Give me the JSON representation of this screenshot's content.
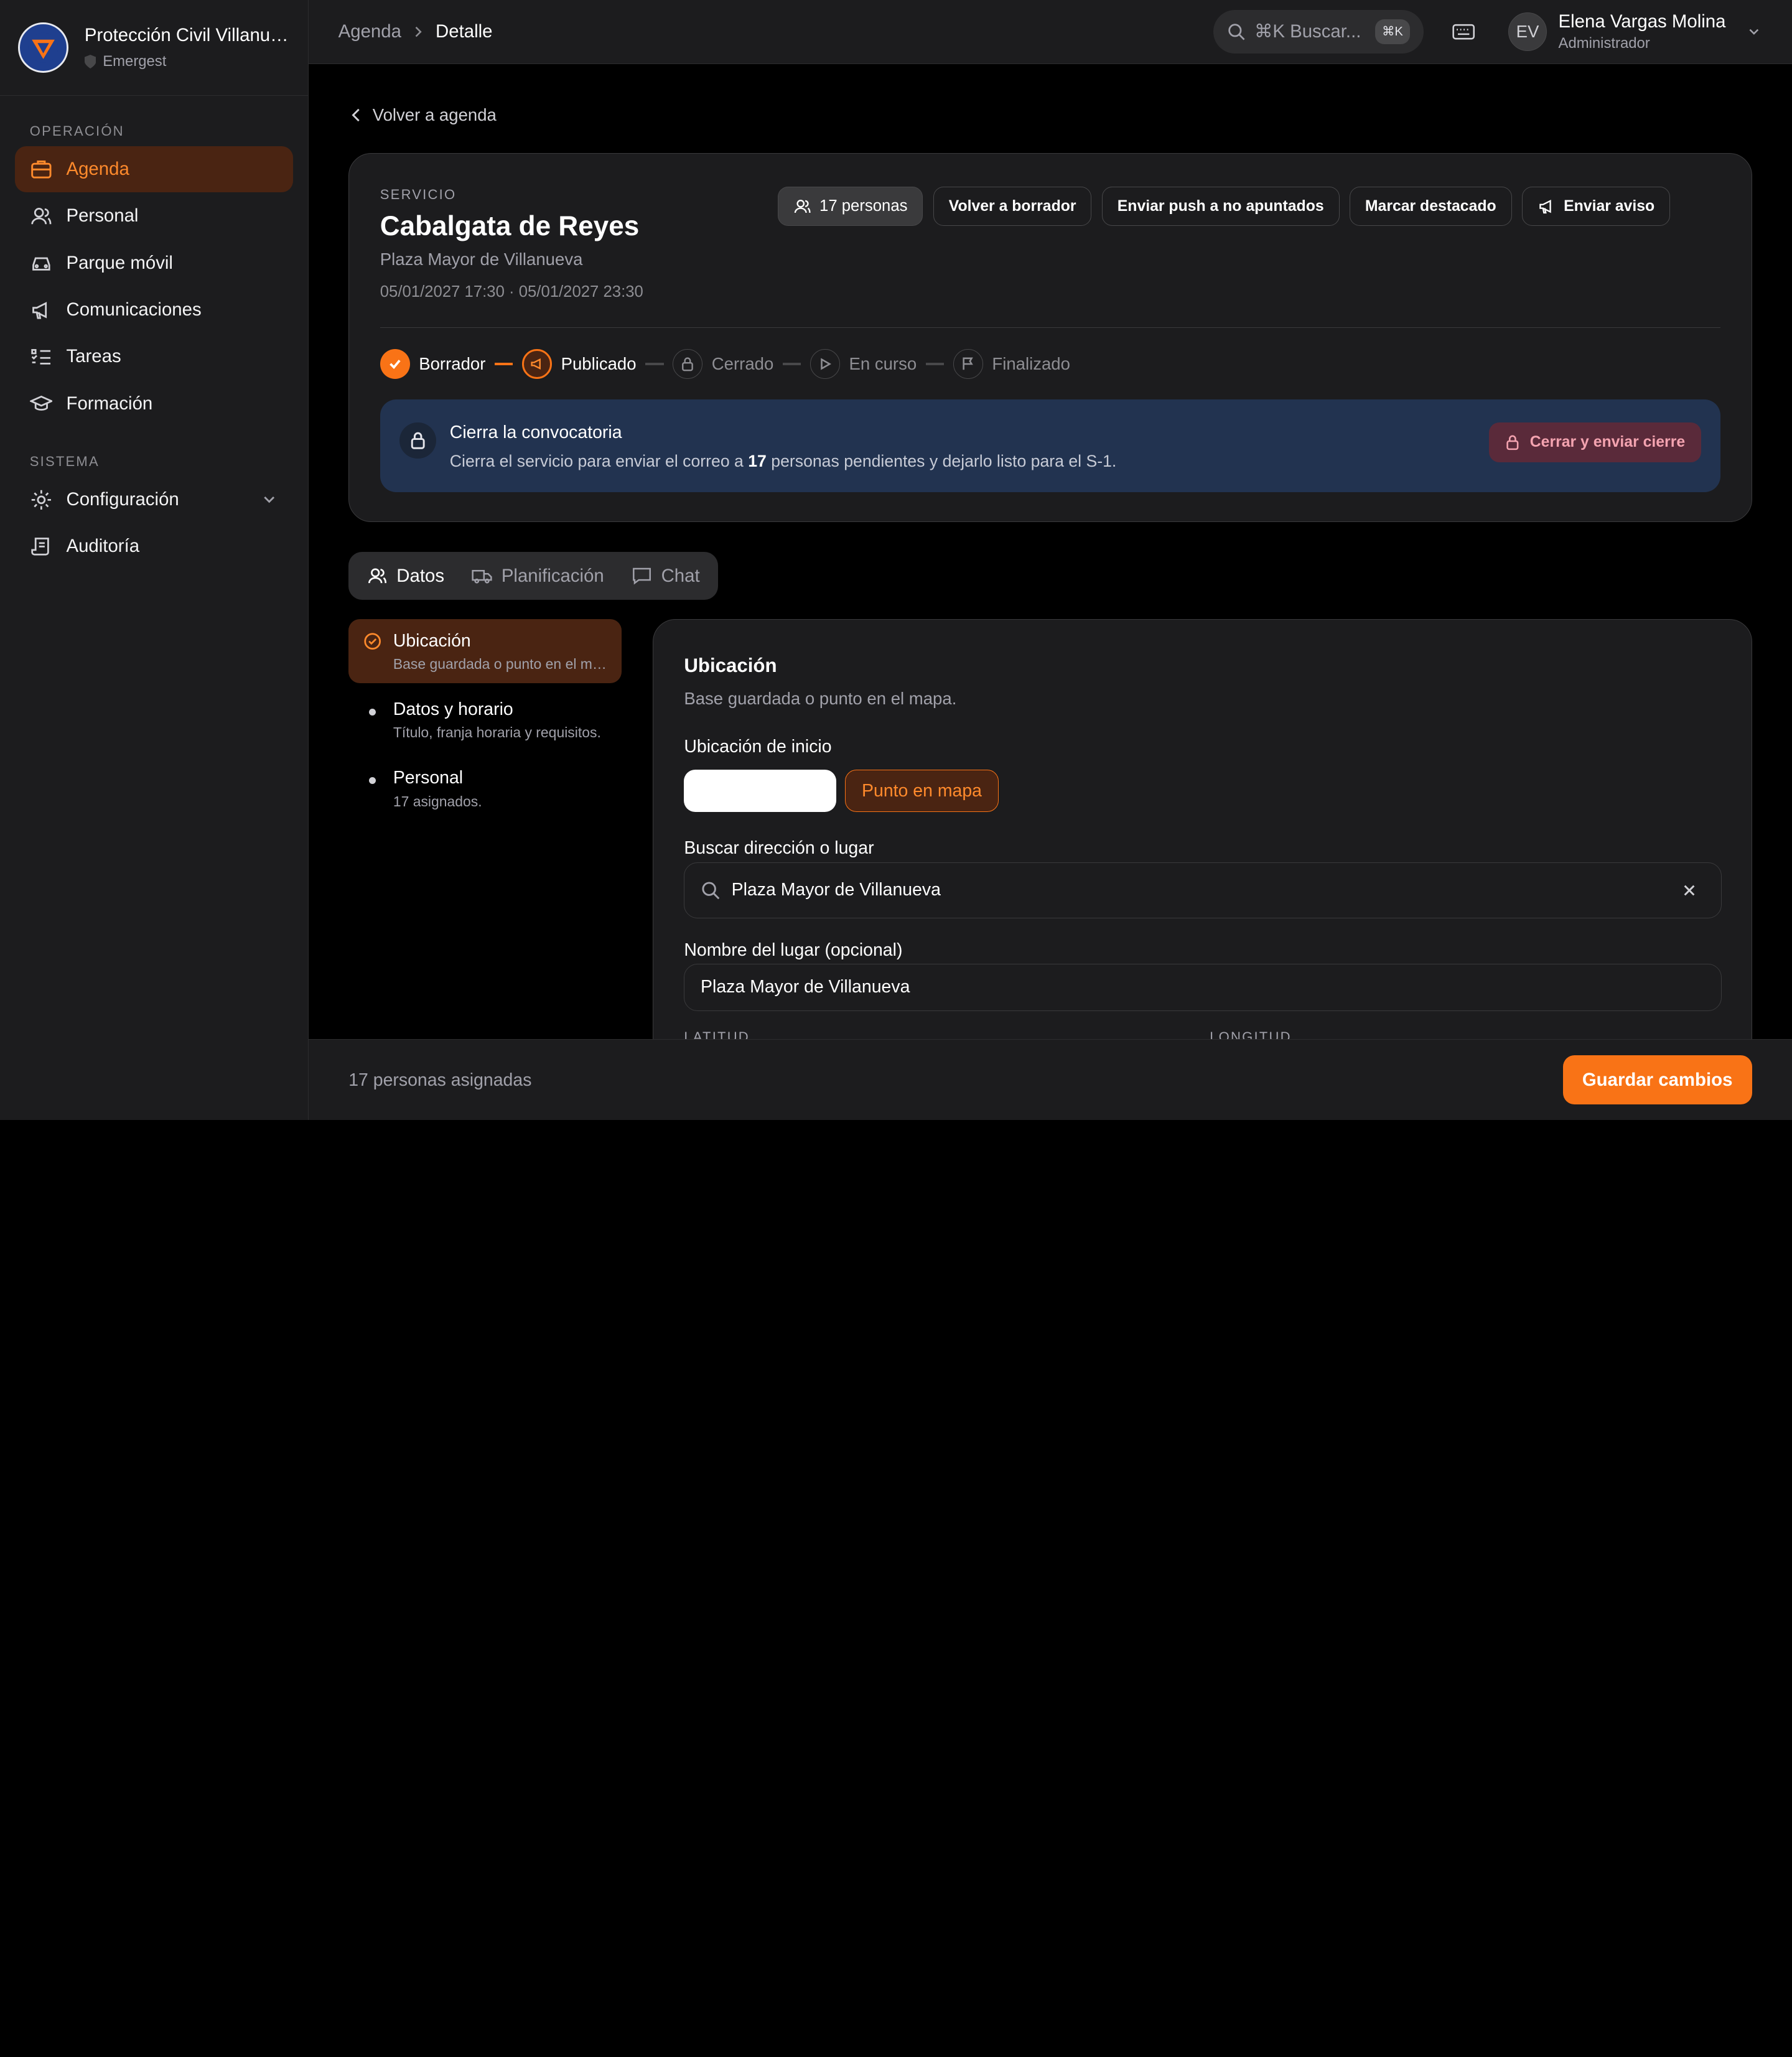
{
  "org": {
    "name": "Protección Civil Villanueva",
    "product": "Emergest"
  },
  "sidebar": {
    "section_operacion": "OPERACIÓN",
    "section_sistema": "SISTEMA",
    "items": [
      {
        "label": "Agenda",
        "icon": "briefcase-icon"
      },
      {
        "label": "Personal",
        "icon": "users-icon"
      },
      {
        "label": "Parque móvil",
        "icon": "car-icon"
      },
      {
        "label": "Comunicaciones",
        "icon": "megaphone-icon"
      },
      {
        "label": "Tareas",
        "icon": "list-checks-icon"
      },
      {
        "label": "Formación",
        "icon": "graduation-cap-icon"
      },
      {
        "label": "Configuración",
        "icon": "gear-icon"
      },
      {
        "label": "Auditoría",
        "icon": "scroll-icon"
      }
    ]
  },
  "header": {
    "breadcrumb": [
      "Agenda",
      "Detalle"
    ],
    "search_placeholder": "⌘K Buscar...",
    "search_shortcut": "⌘K",
    "user": {
      "initials": "EV",
      "name": "Elena Vargas Molina",
      "role": "Administrador"
    }
  },
  "back_label": "Volver a agenda",
  "service": {
    "kicker": "SERVICIO",
    "title": "Cabalgata de Reyes",
    "place": "Plaza Mayor de Villanueva",
    "dates": "05/01/2027 17:30 · 05/01/2027 23:30",
    "people_count": "17 personas",
    "actions": [
      "Volver a borrador",
      "Enviar push a no apuntados",
      "Marcar destacado",
      "Enviar aviso"
    ]
  },
  "status_steps": [
    {
      "label": "Borrador",
      "state": "done"
    },
    {
      "label": "Publicado",
      "state": "current"
    },
    {
      "label": "Cerrado",
      "state": "todo"
    },
    {
      "label": "En curso",
      "state": "todo"
    },
    {
      "label": "Finalizado",
      "state": "todo"
    }
  ],
  "banner": {
    "title": "Cierra la convocatoria",
    "text_before": "Cierra el servicio para enviar el correo a ",
    "count": "17",
    "text_after": " personas pendientes y dejarlo listo para el S-1.",
    "button": "Cerrar y enviar cierre"
  },
  "tabs": [
    "Datos",
    "Planificación",
    "Chat"
  ],
  "form_steps": [
    {
      "title": "Ubicación",
      "subtitle": "Base guardada o punto en el mapa."
    },
    {
      "title": "Datos y horario",
      "subtitle": "Título, franja horaria y requisitos."
    },
    {
      "title": "Personal",
      "subtitle": "17 asignados."
    }
  ],
  "form": {
    "title": "Ubicación",
    "subtitle": "Base guardada o punto en el mapa.",
    "start_label": "Ubicación de inicio",
    "option_map": "Punto en mapa",
    "search_label": "Buscar dirección o lugar",
    "search_value": "Plaza Mayor de Villanueva",
    "name_label": "Nombre del lugar (opcional)",
    "name_value": "Plaza Mayor de Villanueva",
    "lat_label": "LATITUD",
    "lon_label": "LONGITUD"
  },
  "footer": {
    "assigned": "17 personas asignadas",
    "save": "Guardar cambios"
  },
  "colors": {
    "accent": "#f97316",
    "banner": "#223350",
    "background": "#000000"
  }
}
